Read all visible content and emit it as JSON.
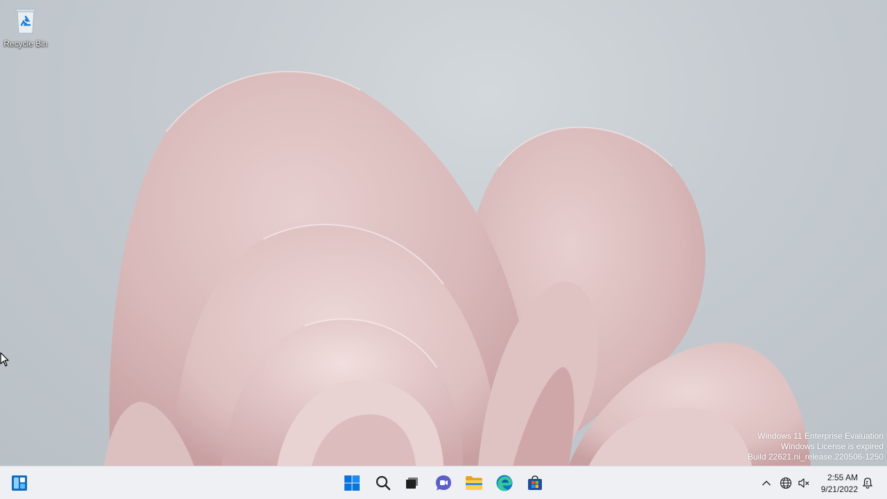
{
  "desktop": {
    "icons": [
      {
        "label": "Recycle Bin",
        "icon": "recycle-bin-icon"
      }
    ]
  },
  "watermark": {
    "line1": "Windows 11 Enterprise Evaluation",
    "line2": "Windows License is expired",
    "line3": "Build 22621.ni_release.220506-1250"
  },
  "taskbar": {
    "pinned": [
      {
        "name": "Widgets",
        "icon": "widgets-icon"
      },
      {
        "name": "Start",
        "icon": "windows-logo-icon"
      },
      {
        "name": "Search",
        "icon": "search-icon"
      },
      {
        "name": "Task View",
        "icon": "task-view-icon"
      },
      {
        "name": "Chat",
        "icon": "chat-icon"
      },
      {
        "name": "File Explorer",
        "icon": "folder-icon"
      },
      {
        "name": "Microsoft Edge",
        "icon": "edge-icon"
      },
      {
        "name": "Microsoft Store",
        "icon": "store-icon"
      }
    ],
    "tray": {
      "icons": [
        "chevron-up-icon",
        "network-icon",
        "volume-muted-icon",
        "notification-icon"
      ],
      "time": "2:55 AM",
      "date": "9/21/2022"
    }
  },
  "colors": {
    "start_blue": "#0078d4",
    "chat_purple": "#6264a7",
    "folder_yellow": "#f8c537",
    "edge_blue": "#0c77c7",
    "edge_green": "#34c28b"
  }
}
